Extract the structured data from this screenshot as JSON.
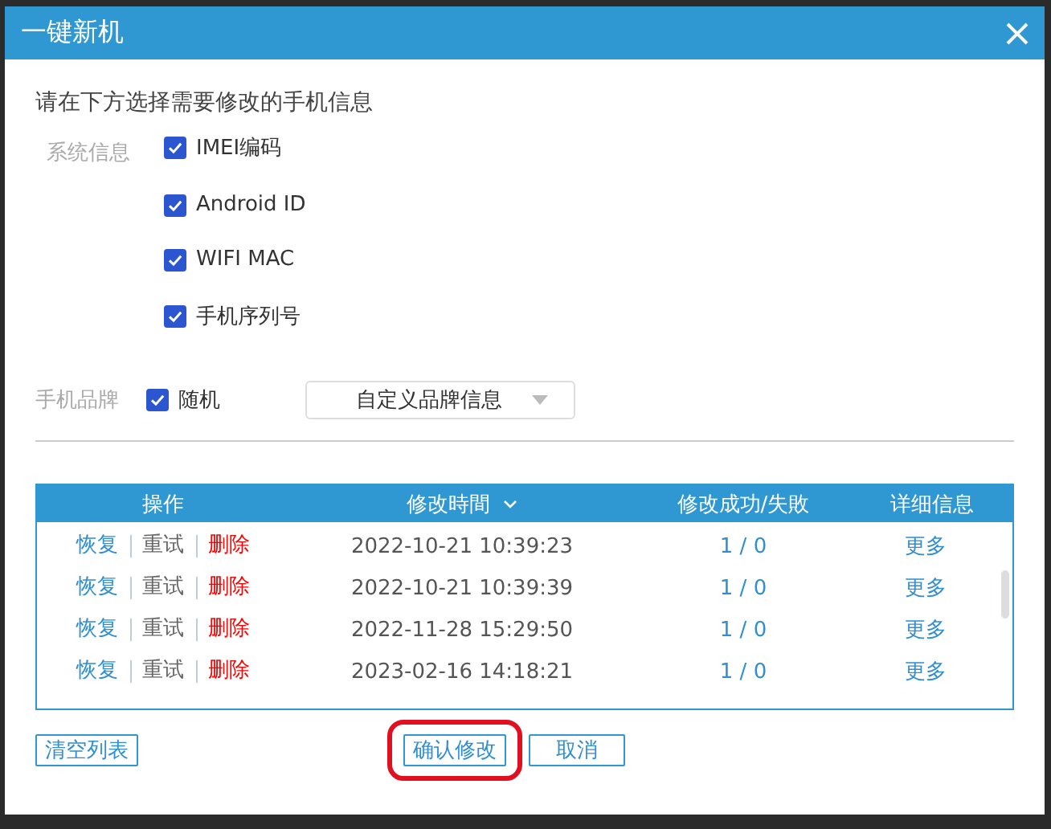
{
  "window": {
    "title": "一键新机"
  },
  "instruction": "请在下方选择需要修改的手机信息",
  "system_info": {
    "label": "系统信息",
    "options": [
      {
        "label": "IMEI编码",
        "checked": true
      },
      {
        "label": "Android ID",
        "checked": true
      },
      {
        "label": "WIFI MAC",
        "checked": true
      },
      {
        "label": "手机序列号",
        "checked": true
      }
    ]
  },
  "brand": {
    "label": "手机品牌",
    "random": {
      "label": "随机",
      "checked": true
    },
    "dropdown": {
      "value": "自定义品牌信息"
    }
  },
  "table": {
    "columns": [
      {
        "label": "操作",
        "sorted": false
      },
      {
        "label": "修改時間",
        "sorted": true
      },
      {
        "label": "修改成功/失敗",
        "sorted": false
      },
      {
        "label": "详细信息",
        "sorted": false
      }
    ],
    "rows": [
      {
        "actions": [
          {
            "label": "恢复",
            "kind": "link"
          },
          {
            "label": "重试",
            "kind": "plain"
          },
          {
            "label": "删除",
            "kind": "danger"
          }
        ],
        "time": "2022-10-21 10:39:23",
        "result": "1 / 0",
        "details": "更多"
      },
      {
        "actions": [
          {
            "label": "恢复",
            "kind": "link"
          },
          {
            "label": "重试",
            "kind": "plain"
          },
          {
            "label": "删除",
            "kind": "danger"
          }
        ],
        "time": "2022-10-21 10:39:39",
        "result": "1 / 0",
        "details": "更多"
      },
      {
        "actions": [
          {
            "label": "恢复",
            "kind": "link"
          },
          {
            "label": "重试",
            "kind": "plain"
          },
          {
            "label": "删除",
            "kind": "danger"
          }
        ],
        "time": "2022-11-28 15:29:50",
        "result": "1 / 0",
        "details": "更多"
      },
      {
        "actions": [
          {
            "label": "恢复",
            "kind": "link"
          },
          {
            "label": "重试",
            "kind": "plain"
          },
          {
            "label": "删除",
            "kind": "danger"
          }
        ],
        "time": "2023-02-16 14:18:21",
        "result": "1 / 0",
        "details": "更多"
      }
    ]
  },
  "buttons": [
    {
      "label": "清空列表",
      "highlighted": false
    },
    {
      "label": "确认修改",
      "highlighted": true
    },
    {
      "label": "取消",
      "highlighted": false
    }
  ]
}
